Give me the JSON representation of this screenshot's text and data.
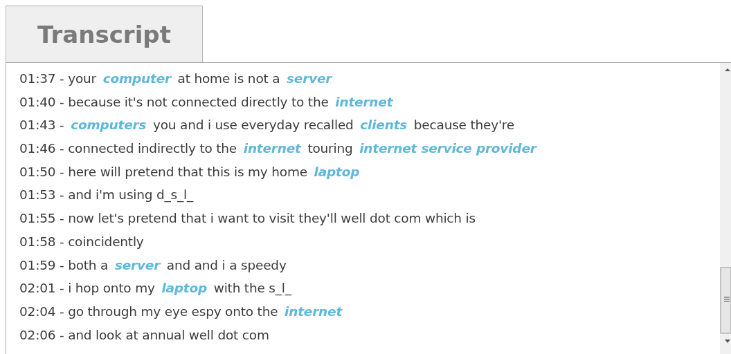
{
  "tab": {
    "label": "Transcript",
    "selected": true
  },
  "lines": [
    "01:37 - your **computer** at home is not a **server**",
    "01:40 - because it's not connected directly to the **internet**",
    "01:43 - **computers** you and i use everyday recalled **clients** because they're",
    "01:46 - connected indirectly to the **internet** touring **internet service provider**",
    "01:50 - here will pretend that this is my home **laptop**",
    "01:53 - and i'm using d_s_l_",
    "01:55 - now let's pretend that i want to visit they'll well dot com which is",
    "01:58 - coincidently",
    "01:59 - both a **server** and and i a speedy",
    "02:01 - i hop onto my **laptop** with the s_l_",
    "02:04 - go through my eye espy onto the **internet**",
    "02:06 - and look at annual well dot com"
  ]
}
